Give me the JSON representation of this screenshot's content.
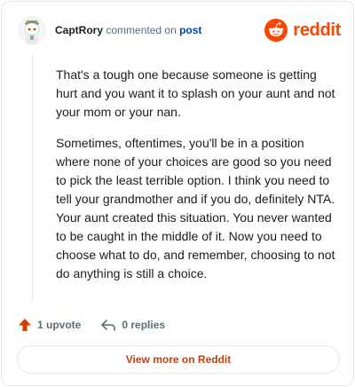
{
  "colors": {
    "brand": "#ff4500",
    "link": "#0045ac",
    "view_more": "#c53f0c",
    "muted": "#576f76",
    "text": "#1c1c1c"
  },
  "header": {
    "username": "CaptRory",
    "action_text": "commented on",
    "post_link": "post",
    "brand_name": "reddit",
    "avatar_icon": "snoo-avatar-icon",
    "brand_icon": "reddit-snoo-logo"
  },
  "comment": {
    "paragraphs": [
      "That's a tough one because someone is getting hurt and you want it to splash on your aunt and not your mom or your nan.",
      "Sometimes, oftentimes, you'll be in a position where none of your choices are good so you need to pick the least terrible option. I think you need to tell your grandmother and if you do, definitely NTA. Your aunt created this situation. You never wanted to be caught in the middle of it. Now you need to choose what to do, and remember, choosing to not do anything is still a choice."
    ]
  },
  "actions": {
    "upvote_label": "1 upvote",
    "upvote_icon": "upvote-arrow-icon",
    "replies_label": "0 replies",
    "replies_icon": "reply-arrow-icon"
  },
  "footer": {
    "view_more_label": "View more on Reddit"
  }
}
